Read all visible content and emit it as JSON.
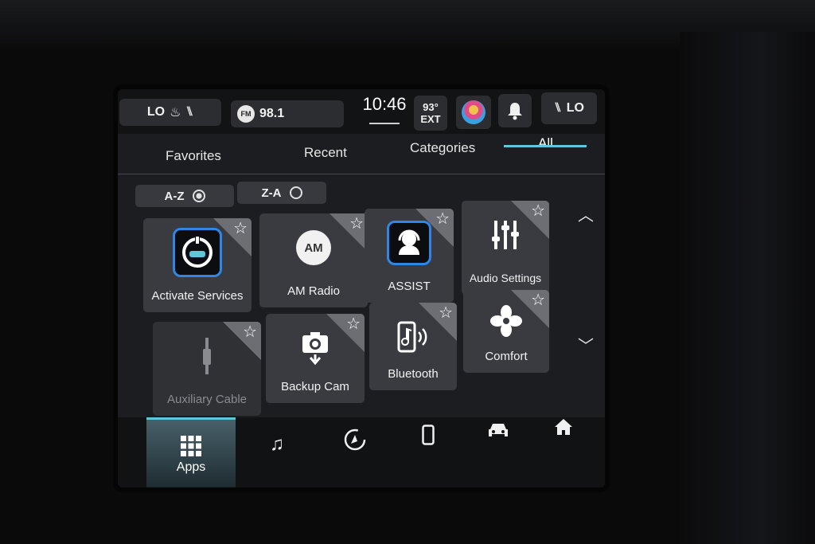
{
  "status": {
    "left_climate": "LO",
    "radio_band": "FM",
    "radio_freq": "98.1",
    "clock": "10:46",
    "temp_value": "93°",
    "temp_label": "EXT",
    "right_climate": "LO"
  },
  "tabs": [
    {
      "label": "Favorites"
    },
    {
      "label": "Recent"
    },
    {
      "label": "Categories"
    },
    {
      "label": "All",
      "active": true
    }
  ],
  "sort": {
    "az": "A-Z",
    "za": "Z-A",
    "selected": "A-Z"
  },
  "apps": [
    {
      "label": "Activate Services",
      "icon": "connected-car-icon"
    },
    {
      "label": "AM Radio",
      "icon": "am-radio-icon",
      "badge": "AM"
    },
    {
      "label": "ASSIST",
      "icon": "assist-icon"
    },
    {
      "label": "Audio Settings",
      "icon": "equalizer-icon"
    },
    {
      "label": "Auxiliary Cable",
      "icon": "aux-cable-icon",
      "disabled": true
    },
    {
      "label": "Backup Cam",
      "icon": "camera-icon"
    },
    {
      "label": "Bluetooth",
      "icon": "bluetooth-phone-icon"
    },
    {
      "label": "Comfort",
      "icon": "fan-icon"
    }
  ],
  "nav": {
    "apps_label": "Apps"
  },
  "colors": {
    "accent": "#5fc6dd",
    "icon_blue": "#2f86e6"
  }
}
